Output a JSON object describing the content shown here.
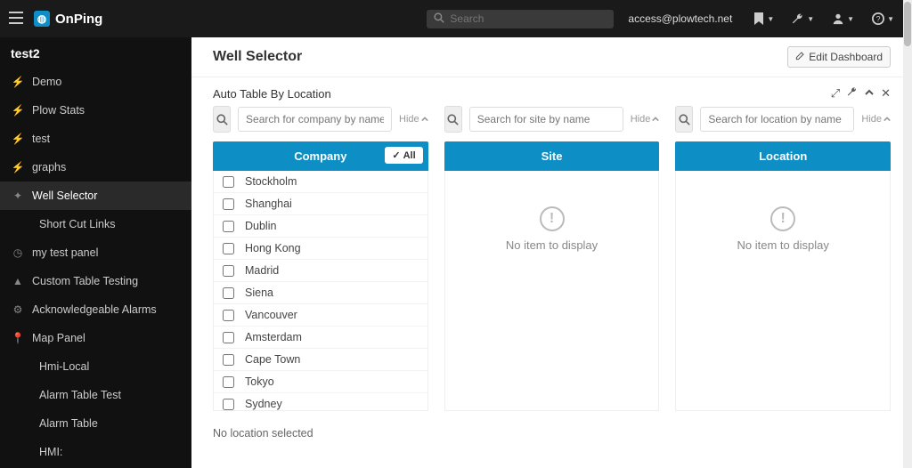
{
  "header": {
    "brand": "OnPing",
    "search_placeholder": "Search",
    "account": "access@plowtech.net"
  },
  "sidebar": {
    "workspace": "test2",
    "items": [
      {
        "icon": "lightning",
        "label": "Demo",
        "active": false,
        "sub": false
      },
      {
        "icon": "lightning",
        "label": "Plow Stats",
        "active": false,
        "sub": false
      },
      {
        "icon": "lightning",
        "label": "test",
        "active": false,
        "sub": false
      },
      {
        "icon": "lightning",
        "label": "graphs",
        "active": false,
        "sub": false
      },
      {
        "icon": "puzzle",
        "label": "Well Selector",
        "active": true,
        "sub": false
      },
      {
        "icon": "",
        "label": "Short Cut Links",
        "active": false,
        "sub": true
      },
      {
        "icon": "gauge",
        "label": "my test panel",
        "active": false,
        "sub": false
      },
      {
        "icon": "warning",
        "label": "Custom Table Testing",
        "active": false,
        "sub": false
      },
      {
        "icon": "gear",
        "label": "Acknowledgeable Alarms",
        "active": false,
        "sub": false
      },
      {
        "icon": "pin",
        "label": "Map Panel",
        "active": false,
        "sub": false
      },
      {
        "icon": "",
        "label": "Hmi-Local",
        "active": false,
        "sub": true
      },
      {
        "icon": "",
        "label": "Alarm Table Test",
        "active": false,
        "sub": true
      },
      {
        "icon": "",
        "label": "Alarm Table",
        "active": false,
        "sub": true
      },
      {
        "icon": "",
        "label": "HMI:",
        "active": false,
        "sub": true
      }
    ]
  },
  "page": {
    "title": "Well Selector",
    "edit_label": "Edit Dashboard"
  },
  "panel": {
    "title": "Auto Table By Location",
    "status": "No location selected"
  },
  "selector": {
    "hide_label": "Hide",
    "all_label": "All",
    "empty_text": "No item to display",
    "columns": [
      {
        "header": "Company",
        "search_placeholder": "Search for company by name"
      },
      {
        "header": "Site",
        "search_placeholder": "Search for site by name"
      },
      {
        "header": "Location",
        "search_placeholder": "Search for location by name"
      }
    ],
    "company_items": [
      "Stockholm",
      "Shanghai",
      "Dublin",
      "Hong Kong",
      "Madrid",
      "Siena",
      "Vancouver",
      "Amsterdam",
      "Cape Town",
      "Tokyo",
      "Sydney"
    ]
  },
  "icons": {
    "lightning": "⚡",
    "puzzle": "✦",
    "gauge": "◷",
    "warning": "▲",
    "gear": "⚙",
    "pin": "📍"
  }
}
